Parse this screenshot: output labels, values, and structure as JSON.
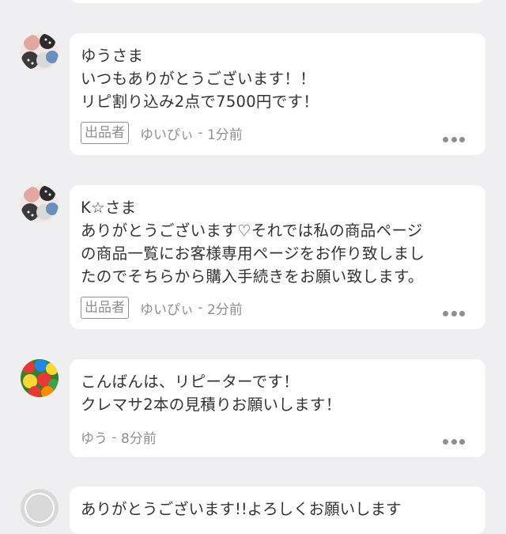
{
  "comments": [
    {
      "lines": [
        "ゆうさま",
        "いつもありがとうございます！！",
        "リピ割り込み2点で7500円です！"
      ],
      "seller_tag": "出品者",
      "author": "ゆいぴぃ",
      "time": "1分前"
    },
    {
      "lines": [
        "K☆さま",
        "ありがとうございます♡それでは私の商品ページ",
        "の商品一覧にお客様専用ページをお作り致しまし",
        "たのでそちらから購入手続きをお願い致します。"
      ],
      "seller_tag": "出品者",
      "author": "ゆいぴぃ",
      "time": "2分前"
    },
    {
      "lines": [
        "こんばんは、リピーターです！",
        "クレマサ2本の見積りお願いします！"
      ],
      "author": "ゆう",
      "time": "8分前"
    },
    {
      "partial_text": "ありがとうございます!!よろしくお願いします"
    }
  ],
  "separator": " - ",
  "colors": {
    "background": "#efeff1",
    "card": "#ffffff",
    "meta": "#8e8e93",
    "text": "#333333"
  },
  "icons": [
    "more-dots-icon",
    "avatar-image"
  ]
}
